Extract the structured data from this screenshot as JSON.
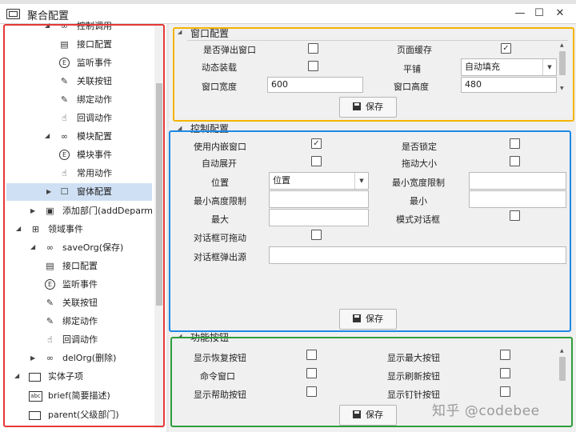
{
  "window": {
    "title": "聚合配置",
    "minimize": "—",
    "maximize": "☐",
    "close": "✕"
  },
  "tree": {
    "items": [
      {
        "label": "控制调用",
        "icon": "link-icon"
      },
      {
        "label": "接口配置",
        "icon": "document-icon"
      },
      {
        "label": "监听事件",
        "icon": "event-icon"
      },
      {
        "label": "关联按钮",
        "icon": "edit-icon"
      },
      {
        "label": "绑定动作",
        "icon": "edit-icon"
      },
      {
        "label": "回调动作",
        "icon": "hand-icon"
      },
      {
        "label": "模块配置",
        "icon": "link-icon"
      },
      {
        "label": "模块事件",
        "icon": "event-icon"
      },
      {
        "label": "常用动作",
        "icon": "hand-icon"
      },
      {
        "label": "窗体配置",
        "icon": "window-icon"
      },
      {
        "label": "添加部门(addDeparment",
        "icon": "panel-icon"
      },
      {
        "label": "领域事件",
        "icon": "grid-icon"
      },
      {
        "label": "saveOrg(保存)",
        "icon": "link-icon"
      },
      {
        "label": "接口配置",
        "icon": "document-icon"
      },
      {
        "label": "监听事件",
        "icon": "event-icon"
      },
      {
        "label": "关联按钮",
        "icon": "edit-icon"
      },
      {
        "label": "绑定动作",
        "icon": "edit-icon"
      },
      {
        "label": "回调动作",
        "icon": "hand-icon"
      },
      {
        "label": "delOrg(删除)",
        "icon": "link-icon"
      },
      {
        "label": "实体子项",
        "icon": "box-icon"
      },
      {
        "label": "brief(简要描述)",
        "icon": "abc-icon"
      },
      {
        "label": "parent(父级部门)",
        "icon": "box-icon"
      }
    ]
  },
  "window_config": {
    "header": "窗口配置",
    "popup_label": "是否弹出窗口",
    "page_cache_label": "页面缓存",
    "dynamic_load_label": "动态装载",
    "tile_label": "平铺",
    "tile_value": "自动填充",
    "width_label": "窗口宽度",
    "width_value": "600",
    "height_label": "窗口高度",
    "height_value": "480",
    "save_label": "保存"
  },
  "control_config": {
    "header": "控制配置",
    "use_embedded_label": "使用内嵌窗口",
    "locked_label": "是否锁定",
    "auto_expand_label": "自动展开",
    "drag_size_label": "拖动大小",
    "position_label": "位置",
    "position_value": "位置",
    "min_width_label": "最小宽度限制",
    "min_height_label": "最小高度限制",
    "min_label": "最小",
    "max_label": "最大",
    "modal_label": "模式对话框",
    "draggable_label": "对话框可拖动",
    "dialog_source_label": "对话框弹出源",
    "save_label": "保存"
  },
  "button_config": {
    "header": "功能按钮",
    "show_restore_label": "显示恢复按钮",
    "show_max_label": "显示最大按钮",
    "command_window_label": "命令窗口",
    "show_refresh_label": "显示刷新按钮",
    "show_help_label": "显示帮助按钮",
    "show_pin_label": "显示钉针按钮",
    "save_label": "保存"
  },
  "watermark": "知乎 @codebee",
  "colors": {
    "red_mark": "#e53935",
    "yellow_mark": "#f4b400",
    "blue_mark": "#1e88e5",
    "green_mark": "#2e9d3a",
    "selection": "#cfe0f4"
  }
}
